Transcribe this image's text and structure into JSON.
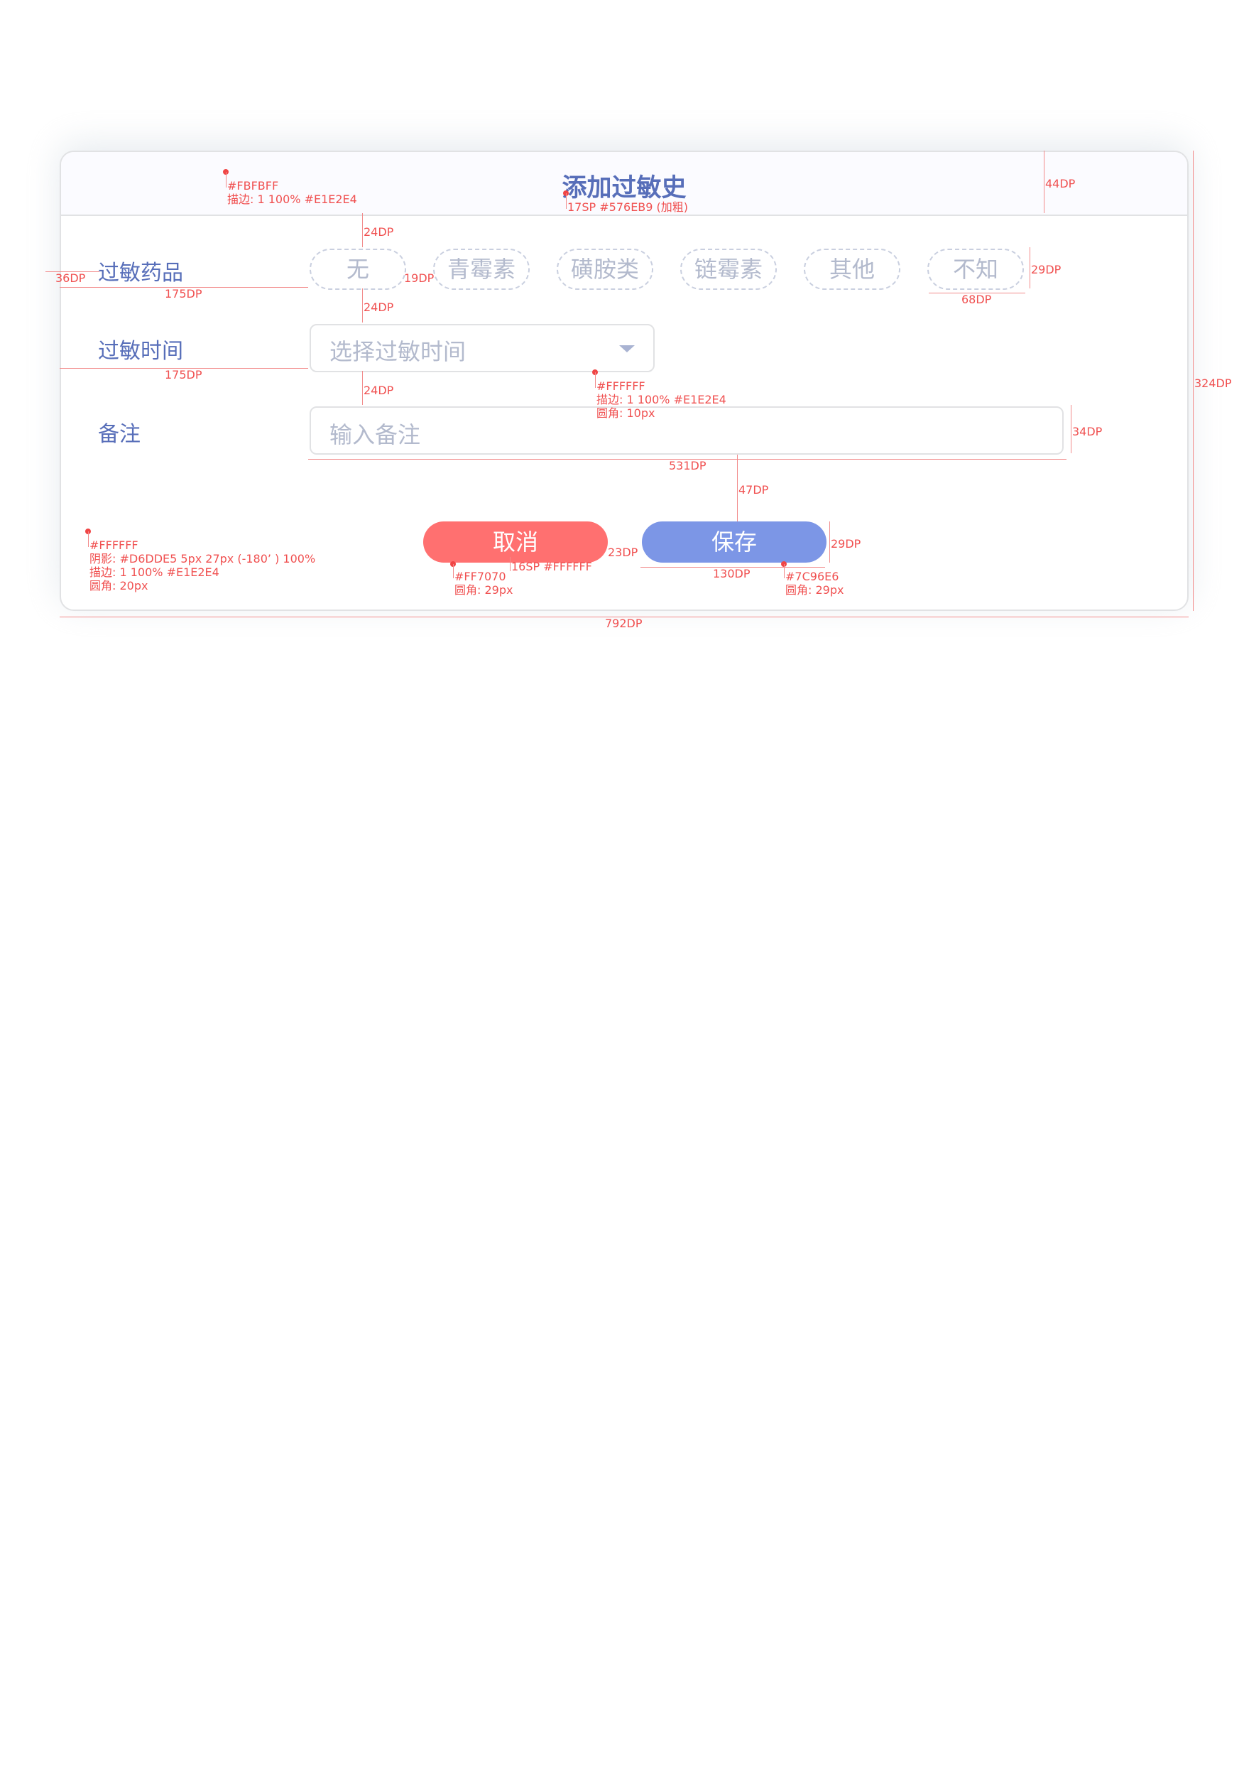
{
  "dialog": {
    "title": "添加过敏史",
    "rows": {
      "drug_label": "过敏药品",
      "time_label": "过敏时间",
      "note_label": "备注"
    },
    "chips": [
      "无",
      "青霉素",
      "磺胺类",
      "链霉素",
      "其他",
      "不知"
    ],
    "time_select": {
      "placeholder": "选择过敏时间"
    },
    "note_input": {
      "placeholder": "输入备注"
    },
    "buttons": {
      "cancel": "取消",
      "save": "保存"
    }
  },
  "annotations": {
    "header_spec": [
      "#FBFBFF",
      "描边: 1 100% #E1E2E4"
    ],
    "title_spec": "17SP #576EB9 (加粗)",
    "header_height": "44DP",
    "gap_a": "24DP",
    "gap_b": "24DP",
    "gap_c": "24DP",
    "left_pad": "36DP",
    "label_width_1": "175DP",
    "label_width_2": "175DP",
    "chip_gap": "19DP",
    "chip_height": "29DP",
    "chip_width": "68DP",
    "dialog_height": "324DP",
    "select_spec": [
      "#FFFFFF",
      "描边: 1 100% #E1E2E4",
      "圆角: 10px"
    ],
    "note_height": "34DP",
    "note_width": "531DP",
    "note_to_btn": "47DP",
    "dialog_spec": [
      "#FFFFFF",
      "阴影: #D6DDE5 5px 27px (-180’ ) 100%",
      "描边: 1 100% #E1E2E4",
      "圆角: 20px"
    ],
    "cancel_spec": [
      "#FF7070",
      "圆角: 29px"
    ],
    "btn_text_spec": "16SP #FFFFFF",
    "btn_gap": "23DP",
    "btn_width": "130DP",
    "btn_height": "29DP",
    "save_spec": [
      "#7C96E6",
      "圆角: 29px"
    ],
    "dialog_width": "792DP"
  },
  "colors": {
    "title": "#576EB9",
    "header_bg": "#FBFBFF",
    "border": "#E1E2E4",
    "cancel": "#FF7070",
    "save": "#7C96E6",
    "annotation": "#F05050"
  }
}
